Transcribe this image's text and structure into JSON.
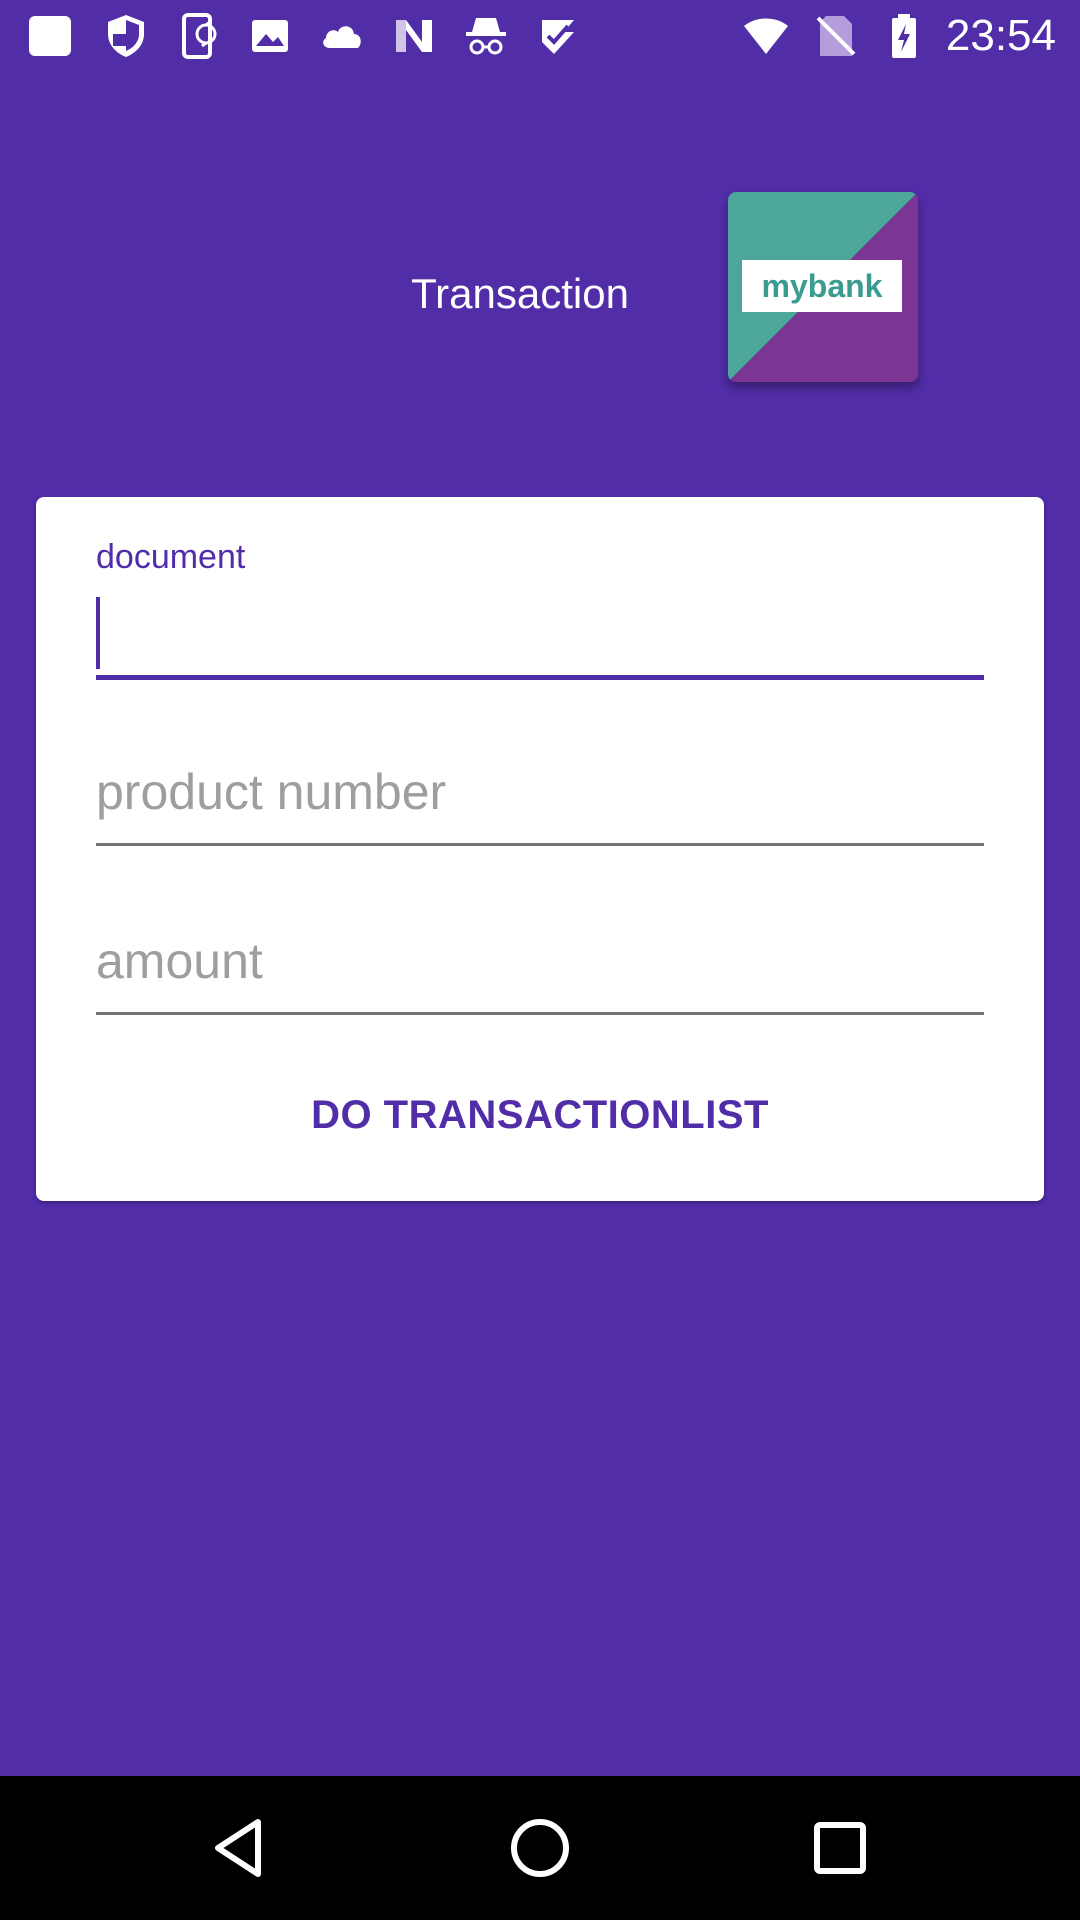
{
  "status_bar": {
    "time": "23:54",
    "left_icons": [
      "notification-square-icon",
      "shield-icon",
      "phone-sync-icon",
      "image-icon",
      "cloud-icon",
      "n-logo-icon",
      "incognito-icon",
      "checkmark-icon"
    ],
    "right_icons": [
      "wifi-icon",
      "no-sim-icon",
      "battery-charging-icon"
    ]
  },
  "header": {
    "title": "Transaction",
    "logo_text": "mybank"
  },
  "form": {
    "document": {
      "label": "document",
      "value": ""
    },
    "product_number": {
      "placeholder": "product number",
      "value": ""
    },
    "amount": {
      "placeholder": "amount",
      "value": ""
    },
    "submit_label": "DO TRANSACTIONLIST"
  },
  "nav_bar": {
    "buttons": [
      "back-icon",
      "home-icon",
      "recents-icon"
    ]
  },
  "colors": {
    "primary": "#512DA8",
    "card": "#FFFFFF",
    "nav_bar": "#000000",
    "logo_teal": "#4CA79A",
    "logo_purple": "#7B3594"
  }
}
